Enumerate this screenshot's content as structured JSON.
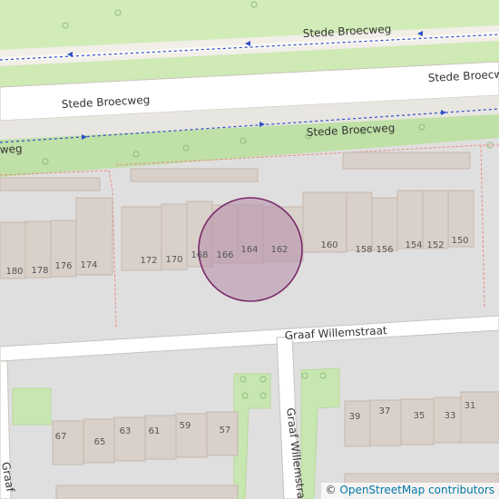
{
  "map": {
    "streets": {
      "stede_broecweg": "Stede Broecweg",
      "stede_broecweg_cut": "Stede Broecwe",
      "stede_broecweg_left": "weg",
      "graaf_willemstraat": "Graaf Willemstraat",
      "graaf_willemstraat_vertical": "Graaf Willemstraa",
      "graaf_bottom_left": "Graaf"
    },
    "house_numbers_row1": [
      "180",
      "178",
      "176",
      "174"
    ],
    "house_numbers_row2": [
      "172",
      "170",
      "168",
      "166",
      "164",
      "162",
      "160",
      "158",
      "156",
      "154",
      "152",
      "150"
    ],
    "house_numbers_row3": [
      "67",
      "65",
      "63",
      "61",
      "59",
      "57"
    ],
    "house_numbers_row4": [
      "39",
      "37",
      "35",
      "33",
      "31"
    ],
    "selected_house": "164"
  },
  "attribution": {
    "copyright_symbol": "©",
    "link_text": "OpenStreetMap contributors"
  },
  "colors": {
    "background": "#e0dfdf",
    "grass": "#c8e6b0",
    "road": "#ffffff",
    "building": "#d9d0c9",
    "building_stroke": "#c4b8ae",
    "marker_fill": "#b48ca8",
    "marker_stroke": "#7a2a6a",
    "path_blue": "#3050c8"
  }
}
